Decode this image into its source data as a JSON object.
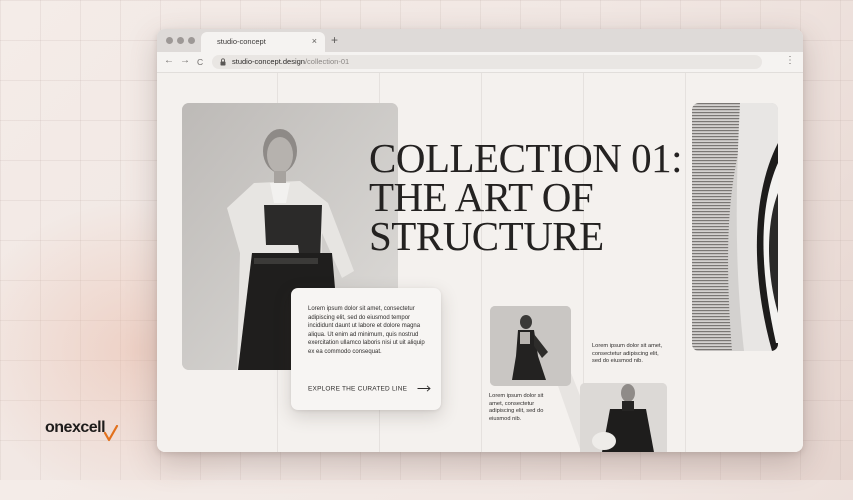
{
  "browser": {
    "tab_title": "studio-concept",
    "tab_close": "×",
    "new_tab": "+",
    "url_host": "studio-concept.design",
    "url_path": "/collection-01",
    "back": "←",
    "forward": "→",
    "reload": "C",
    "menu": "⋮"
  },
  "hero": {
    "title_lines": [
      "COLLECTION 01:",
      "THE ART OF",
      "STRUCTURE"
    ]
  },
  "card": {
    "body": "Lorem ipsum dolor sit amet, consectetur adipiscing elit, sed do eiusmod tempor incididunt daunt ut labore et dolore magna aliqua. Ut enim ad minimum, quis nostrud exercitation ullamco laboris nisi ut uit aliquip ex ea commodo consequat.",
    "cta_label": "EXPLORE THE CURATED LINE"
  },
  "blurbs": {
    "right": "Lorem ipsum dolor sit amet, consectetur adipiscing elit, sed do eiusmod nib.",
    "left": "Lorem ipsum dolor sit amet, consectetur adipiscing elit, sed do eiusmod nib."
  },
  "brand": {
    "logo_text": "onexcell",
    "accent": "#e2711d"
  },
  "icons": {
    "lock": "lock-icon",
    "cta": "arrow-right-icon"
  }
}
